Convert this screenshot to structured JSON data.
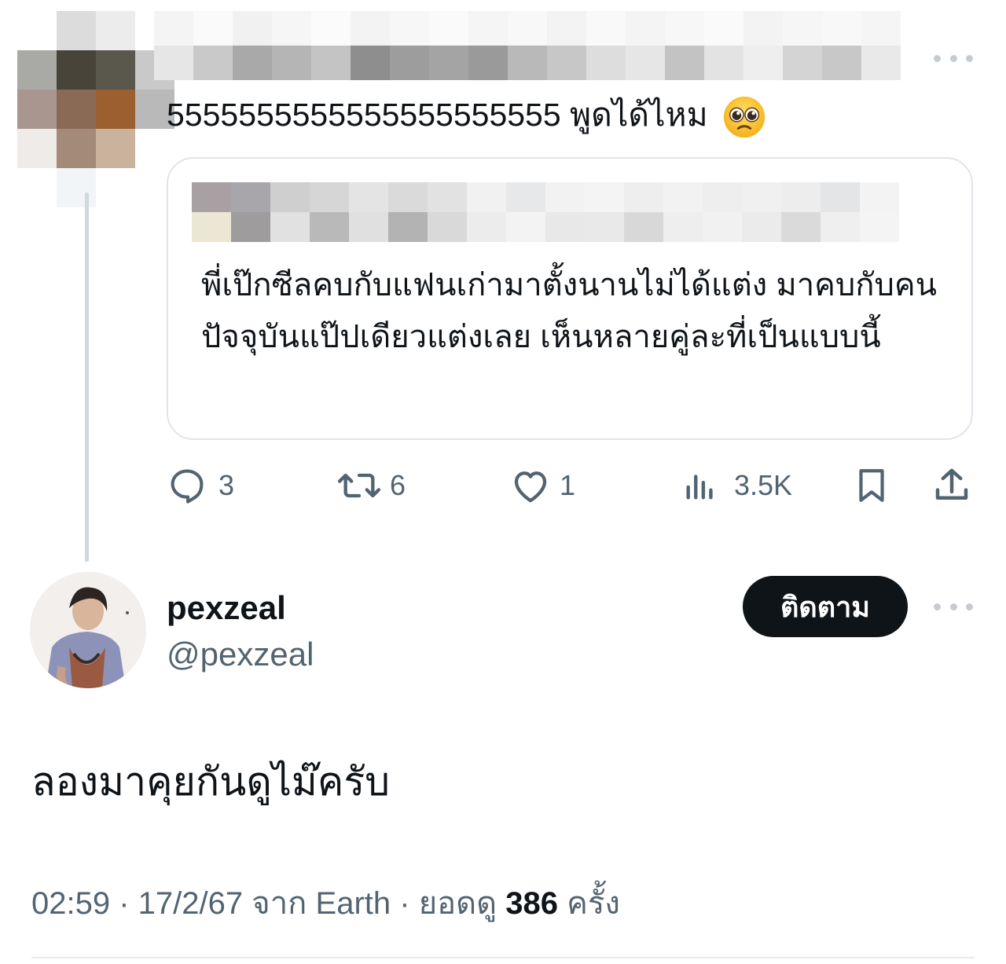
{
  "reply": {
    "text": "5555555555555555555555 พูดได้ไหม",
    "emoji": "pleading-face-emoji"
  },
  "quoted": {
    "text": "พี่เป๊กซีลคบกับแฟนเก่ามาตั้งนานไม่ได้แต่ง มาคบกับคนปัจจุบันแป๊ปเดียวแต่งเลย เห็นหลายคู่ละที่เป็นแบบนี้"
  },
  "actions": {
    "replies": "3",
    "reposts": "6",
    "likes": "1",
    "views": "3.5K"
  },
  "author": {
    "name": "pexzeal",
    "handle": "@pexzeal",
    "follow_label": "ติดตาม"
  },
  "post": {
    "text": "ลองมาคุยกันดูไม๊ครับ",
    "time": "02:59",
    "date": "17/2/67",
    "source_prefix": "จาก",
    "source": "Earth",
    "views_prefix": "ยอดดู",
    "views_count": "386",
    "views_suffix": "ครั้ง"
  },
  "colors": {
    "text": "#0f1419",
    "secondary": "#536471",
    "border": "#dfe5e9",
    "button": "#0f1419"
  }
}
